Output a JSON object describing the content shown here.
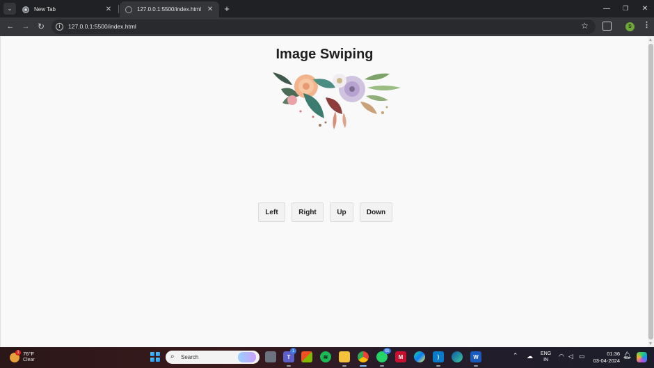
{
  "browser": {
    "tabs": [
      {
        "title": "New Tab",
        "active": false
      },
      {
        "title": "127.0.0.1:5500/index.html",
        "active": true
      }
    ],
    "address_bar": {
      "url": "127.0.0.1:5500/index.html"
    },
    "profile_initial": "S",
    "icons": {
      "tab_search": "chevron-down-icon",
      "new_tab": "plus-icon",
      "back": "arrow-left-icon",
      "forward": "arrow-right-icon",
      "reload": "reload-icon",
      "site_info": "info-icon",
      "bookmark": "star-icon",
      "extensions": "puzzle-icon",
      "menu": "more-vert-icon",
      "minimize": "minimize-icon",
      "maximize": "restore-icon",
      "close": "close-icon"
    }
  },
  "page": {
    "title": "Image Swiping",
    "image": {
      "subject": "floral-bouquet"
    },
    "buttons": {
      "left": "Left",
      "right": "Right",
      "up": "Up",
      "down": "Down"
    }
  },
  "taskbar": {
    "weather": {
      "temp": "76°F",
      "condition": "Clear",
      "badge": "1"
    },
    "search_placeholder": "Search",
    "apps": [
      {
        "name": "task-view",
        "badge": ""
      },
      {
        "name": "teams",
        "badge": "1"
      },
      {
        "name": "microsoft-store",
        "badge": ""
      },
      {
        "name": "spotify",
        "badge": ""
      },
      {
        "name": "file-explorer",
        "badge": ""
      },
      {
        "name": "chrome",
        "badge": ""
      },
      {
        "name": "whatsapp",
        "badge": "65"
      },
      {
        "name": "mcafee",
        "badge": ""
      },
      {
        "name": "pycharm",
        "badge": ""
      },
      {
        "name": "vscode",
        "badge": ""
      },
      {
        "name": "edge",
        "badge": ""
      },
      {
        "name": "word",
        "badge": ""
      }
    ],
    "tray": {
      "lang_line1": "ENG",
      "lang_line2": "IN",
      "time": "01:36",
      "date": "03-04-2024"
    }
  },
  "colors": {
    "page_background": "#f9f9f9",
    "browser_chrome": "#202124",
    "toolbar": "#35363a",
    "profile_avatar": "#6fa83a"
  }
}
